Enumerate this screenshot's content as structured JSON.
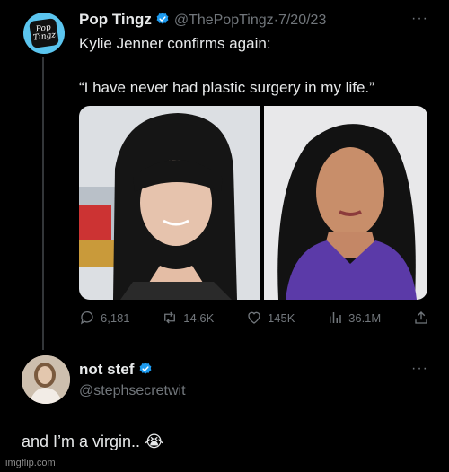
{
  "tweet": {
    "avatar_logo_text": "Pop Tingz",
    "author_name": "Pop Tingz",
    "handle": "@ThePopTingz",
    "separator": "·",
    "date": "7/20/23",
    "line1": "Kylie Jenner confirms again:",
    "quote": "“I have never had plastic surgery in my life.”",
    "stats": {
      "replies": "6,181",
      "reposts": "14.6K",
      "likes": "145K",
      "views": "36.1M"
    },
    "more": "···"
  },
  "reply": {
    "author_name": "not stef",
    "handle": "@stephsecretwit",
    "text": "and I’m a virgin..",
    "emoji": "😭",
    "more": "···"
  },
  "watermark": "imgflip.com",
  "colors": {
    "background": "#000000",
    "text": "#e7e9ea",
    "secondary": "#71767b",
    "verified": "#1d9bf0",
    "avatar_bg": "#5bc5ef"
  }
}
